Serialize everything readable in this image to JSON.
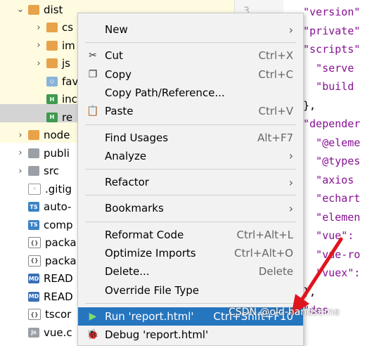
{
  "tree": {
    "rows": [
      {
        "arrow": "⌄",
        "icon": "folder",
        "label": "dist"
      },
      {
        "arrow": "›",
        "icon": "folder",
        "label": "cs"
      },
      {
        "arrow": "›",
        "icon": "folder",
        "label": "im"
      },
      {
        "arrow": "›",
        "icon": "folder",
        "label": "js"
      },
      {
        "arrow": "",
        "icon": "fav",
        "label": "fav"
      },
      {
        "arrow": "",
        "icon": "html",
        "label": "inc"
      },
      {
        "arrow": "",
        "icon": "html",
        "label": "re"
      },
      {
        "arrow": "›",
        "icon": "folder",
        "label": "node"
      },
      {
        "arrow": "›",
        "icon": "folder-g",
        "label": "publi"
      },
      {
        "arrow": "›",
        "icon": "folder-g",
        "label": "src"
      },
      {
        "arrow": "",
        "icon": "gitig",
        "label": ".gitig"
      },
      {
        "arrow": "",
        "icon": "ts",
        "label": "auto-"
      },
      {
        "arrow": "",
        "icon": "ts",
        "label": "comp"
      },
      {
        "arrow": "",
        "icon": "json",
        "label": "packa"
      },
      {
        "arrow": "",
        "icon": "json",
        "label": "packa"
      },
      {
        "arrow": "",
        "icon": "md",
        "label": "READ"
      },
      {
        "arrow": "",
        "icon": "md",
        "label": "READ"
      },
      {
        "arrow": "",
        "icon": "json",
        "label": "tscor"
      },
      {
        "arrow": "",
        "icon": "js",
        "label": "vue.c"
      }
    ],
    "icon_text": {
      "ts": "TS",
      "md": "MD",
      "json": "{}",
      "html": "H",
      "gitig": "◦",
      "fav": "◇",
      "folder": "",
      "folder-g": "",
      "js": "js"
    }
  },
  "gutter": {
    "line_number": "3"
  },
  "code_lines": [
    {
      "text": "\"version\"",
      "cls": "k"
    },
    {
      "text": "\"private\"",
      "cls": "k"
    },
    {
      "text": "\"scripts\"",
      "cls": "k"
    },
    {
      "text": "  \"serve",
      "cls": "k"
    },
    {
      "text": "  \"build",
      "cls": "k"
    },
    {
      "text": "},",
      "cls": "p"
    },
    {
      "text": "\"depender",
      "cls": "k"
    },
    {
      "text": "  \"@eleme",
      "cls": "k"
    },
    {
      "text": "  \"@types",
      "cls": "k"
    },
    {
      "text": "  \"axios",
      "cls": "k"
    },
    {
      "text": "  \"echart",
      "cls": "k"
    },
    {
      "text": "  \"elemen",
      "cls": "k"
    },
    {
      "text": "  \"vue\":",
      "cls": "k"
    },
    {
      "text": "  \"vue-ro",
      "cls": "k"
    },
    {
      "text": "  \"vuex\":",
      "cls": "k"
    },
    {
      "text": "},",
      "cls": "p"
    },
    {
      "text": "\"des",
      "cls": "k"
    }
  ],
  "menu": {
    "items": [
      {
        "label": "New",
        "shortcut": "",
        "submenu": true,
        "icon": ""
      },
      {
        "sep": true
      },
      {
        "label": "Cut",
        "shortcut": "Ctrl+X",
        "icon": "✂",
        "iconName": "cut-icon"
      },
      {
        "label": "Copy",
        "shortcut": "Ctrl+C",
        "icon": "❐",
        "iconName": "copy-icon"
      },
      {
        "label": "Copy Path/Reference...",
        "shortcut": ""
      },
      {
        "label": "Paste",
        "shortcut": "Ctrl+V",
        "icon": "📋",
        "iconName": "paste-icon"
      },
      {
        "sep": true
      },
      {
        "label": "Find Usages",
        "shortcut": "Alt+F7"
      },
      {
        "label": "Analyze",
        "shortcut": "",
        "submenu": true
      },
      {
        "sep": true
      },
      {
        "label": "Refactor",
        "shortcut": "",
        "submenu": true
      },
      {
        "sep": true
      },
      {
        "label": "Bookmarks",
        "shortcut": "",
        "submenu": true
      },
      {
        "sep": true
      },
      {
        "label": "Reformat Code",
        "shortcut": "Ctrl+Alt+L"
      },
      {
        "label": "Optimize Imports",
        "shortcut": "Ctrl+Alt+O"
      },
      {
        "label": "Delete...",
        "shortcut": "Delete"
      },
      {
        "label": "Override File Type",
        "shortcut": ""
      },
      {
        "sep": true
      },
      {
        "label": "Run 'report.html'",
        "shortcut": "Ctrl+Shift+F10",
        "icon": "▶",
        "iconName": "run-icon",
        "active": true
      },
      {
        "label": "Debug 'report.html'",
        "shortcut": "",
        "icon": "🐞",
        "iconName": "debug-icon"
      }
    ]
  },
  "watermark": "CSDN @old-handsome",
  "colors": {
    "accent": "#2675bf",
    "arrow": "#e0141e"
  }
}
